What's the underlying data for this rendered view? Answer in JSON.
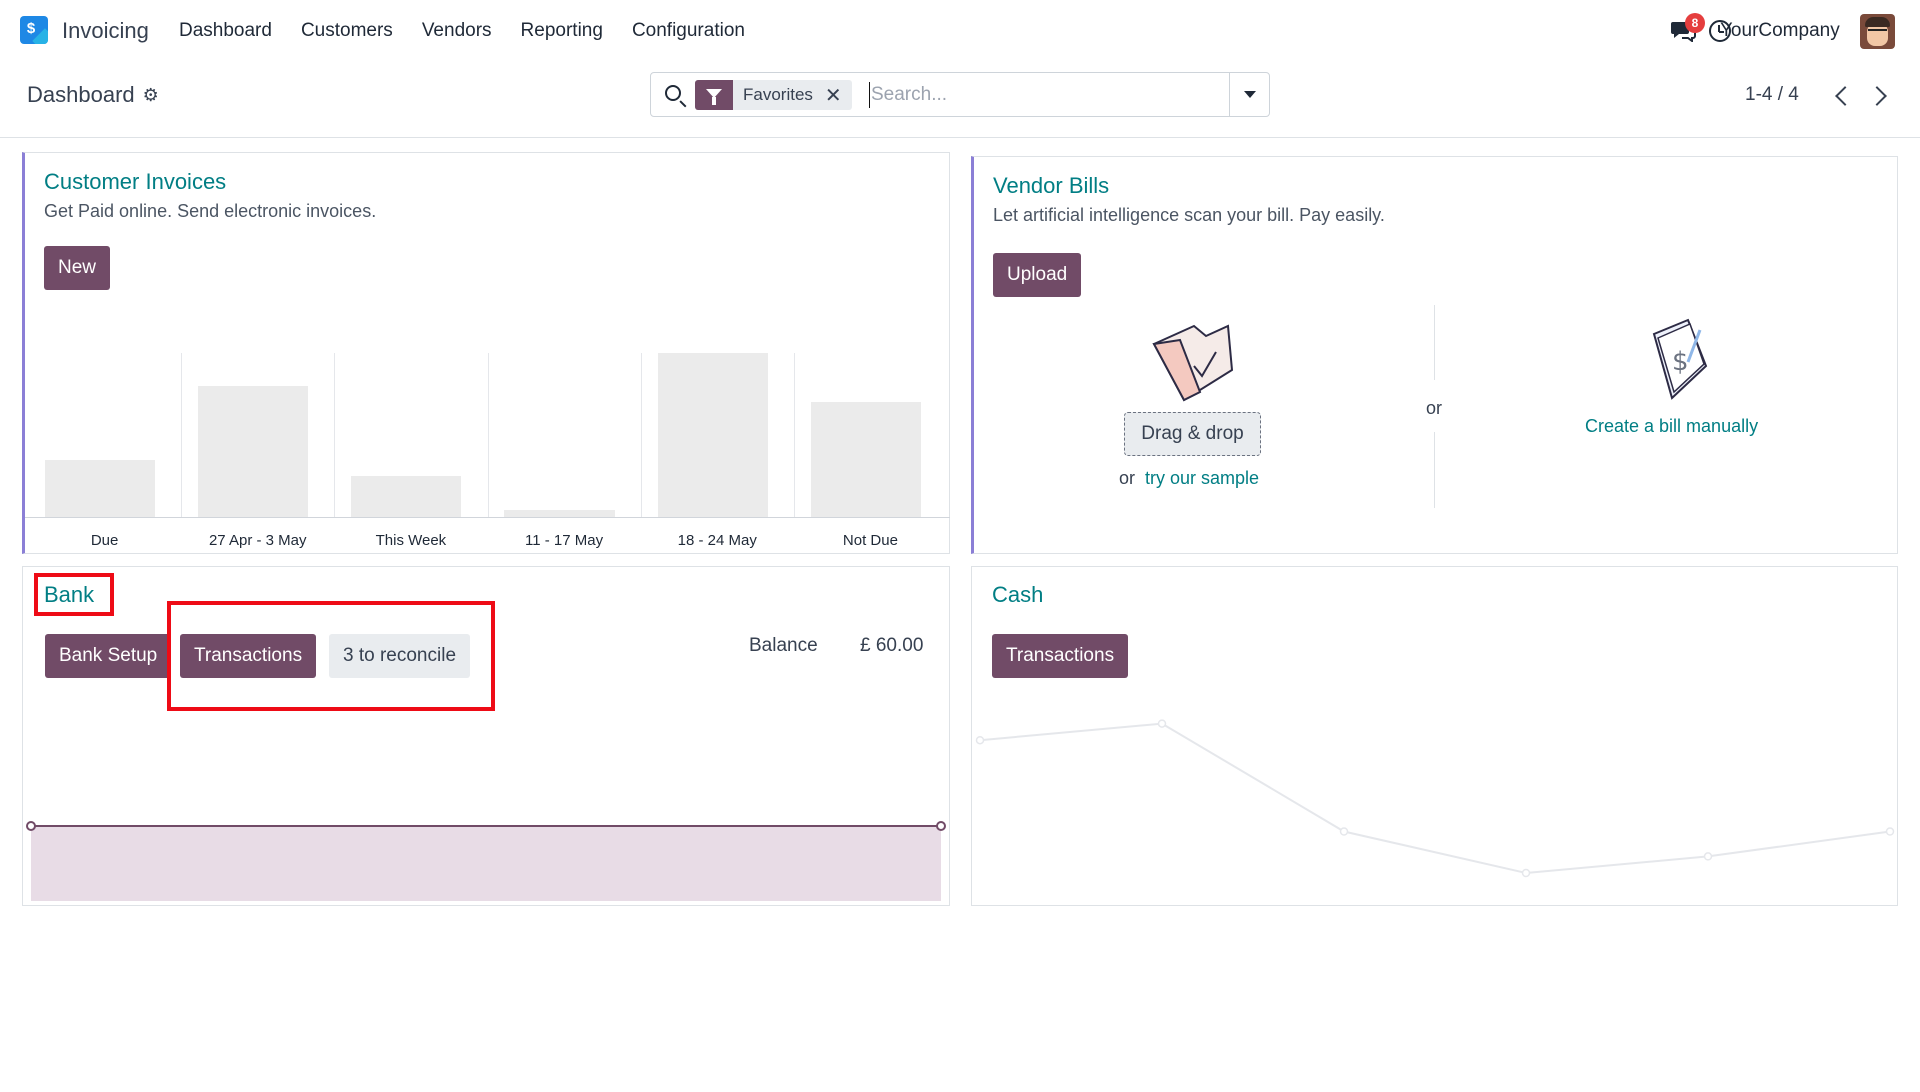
{
  "navbar": {
    "app_icon_glyph": "$",
    "app_name": "Invoicing",
    "menu": [
      "Dashboard",
      "Customers",
      "Vendors",
      "Reporting",
      "Configuration"
    ],
    "notification_count": "8",
    "company": "YourCompany"
  },
  "control": {
    "breadcrumb": "Dashboard",
    "facet_label": "Favorites",
    "facet_close": "✕",
    "search_placeholder": "Search...",
    "pager": "1-4 / 4"
  },
  "customer_invoices": {
    "title": "Customer Invoices",
    "subtitle": "Get Paid online. Send electronic invoices.",
    "new_button": "New",
    "chart_data": {
      "type": "bar",
      "categories": [
        "Due",
        "27 Apr - 3 May",
        "This Week",
        "11 - 17 May",
        "18 - 24 May",
        "Not Due"
      ],
      "values": [
        35,
        80,
        25,
        4,
        100,
        70
      ],
      "ylim": [
        0,
        100
      ],
      "grid": false,
      "legend": "none"
    }
  },
  "vendor_bills": {
    "title": "Vendor Bills",
    "subtitle": "Let artificial intelligence scan your bill. Pay easily.",
    "upload_button": "Upload",
    "drag_drop": "Drag & drop",
    "or_prefix": "or",
    "sample_link": "try our sample",
    "or_separator": "or",
    "manual_link": "Create a bill manually"
  },
  "bank": {
    "title": "Bank",
    "setup_button": "Bank Setup",
    "transactions_button": "Transactions",
    "reconcile_button": "3 to reconcile",
    "balance_label": "Balance",
    "balance_value": "£ 60.00",
    "chart_data": {
      "type": "area",
      "x": [
        0,
        1
      ],
      "values": [
        60,
        60
      ],
      "color": "#714b67"
    }
  },
  "cash": {
    "title": "Cash",
    "transactions_button": "Transactions",
    "chart_data": {
      "type": "line",
      "x": [
        0,
        1,
        2,
        3,
        4,
        5
      ],
      "values": [
        80,
        90,
        25,
        0,
        10,
        25
      ],
      "color": "#e5e7eb"
    }
  },
  "colors": {
    "brand": "#714b67",
    "link": "#017e84",
    "accent_border": "#8b7fd6",
    "highlight": "#ee0b16"
  }
}
